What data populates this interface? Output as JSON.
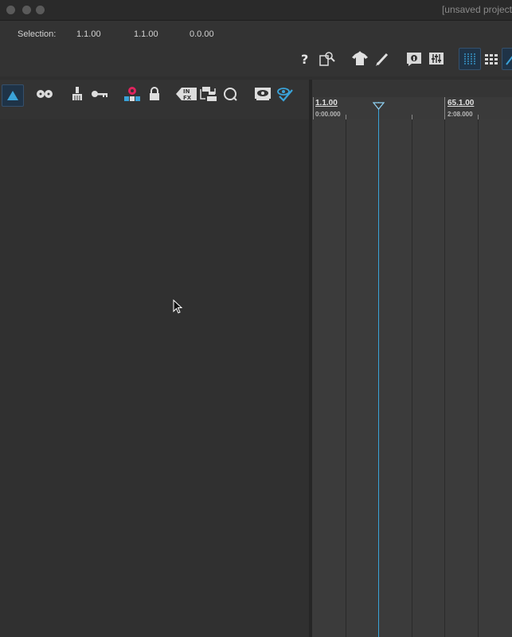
{
  "window": {
    "title": "[unsaved project",
    "traffic_lights": [
      "close",
      "minimize",
      "zoom"
    ]
  },
  "selection": {
    "label": "Selection:",
    "start": "1.1.00",
    "end": "1.1.00",
    "length": "0.0.00"
  },
  "toolbar_top": {
    "icons": [
      "help-icon",
      "file-search-icon",
      "shirt-icon",
      "pen-icon",
      "info-panel-icon",
      "mixer-icon",
      "grid-lines-icon",
      "grid-dots-icon",
      "automation-icon"
    ]
  },
  "track_toolbar": {
    "icons": [
      "collapse-triangle-icon",
      "tape-reels-icon",
      "brush-icon",
      "key-icon",
      "record-arm-icon",
      "lock-icon",
      "infx-icon",
      "swap-tracks-icon",
      "search-circle-icon",
      "show-icon",
      "visibility-check-icon"
    ],
    "infx_label": "IN FX"
  },
  "ruler": {
    "markers": [
      {
        "bar": "1.1.00",
        "time": "0:00.000"
      },
      {
        "bar": "65.1.00",
        "time": "2:08.000"
      }
    ]
  },
  "colors": {
    "accent": "#3aa3d9",
    "background": "#2f2f2f",
    "ruler": "#3a3a3a",
    "timeline": "#3b3b3b",
    "record": "#e0245e"
  }
}
